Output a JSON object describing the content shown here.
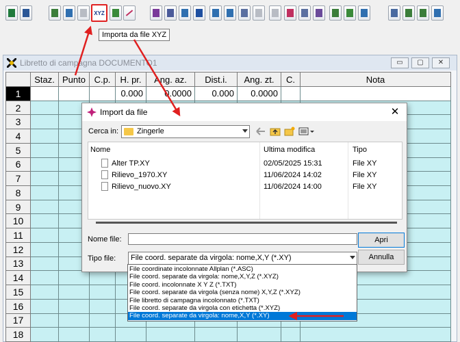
{
  "tooltip": "Importa da file XYZ",
  "toolbar": {
    "xyz_button_text": "XYZ",
    "icons": [
      "excel-icon",
      "word-icon",
      "tool-icon",
      "tool-icon",
      "tool-icon",
      "import-xyz-icon",
      "tool-icon",
      "line-icon",
      "tool-icon",
      "tool-icon",
      "tool-icon",
      "tool-icon",
      "tool-icon",
      "tool-icon",
      "tool-icon",
      "tool-icon",
      "tool-icon",
      "tool-icon",
      "tool-icon",
      "tool-icon",
      "tool-icon",
      "tool-icon",
      "tool-icon",
      "tool-icon",
      "tool-icon",
      "tool-icon",
      "tool-icon"
    ]
  },
  "window": {
    "title": "Libretto di campagna DOCUMENTO1",
    "buttons": [
      "▭",
      "▢",
      "✕"
    ]
  },
  "grid": {
    "columns": [
      "",
      "Staz.",
      "Punto",
      "C.p.",
      "H. pr.",
      "Ang. az.",
      "Dist.i.",
      "Ang. zt.",
      "C.",
      "Nota"
    ],
    "first_row": [
      "1",
      "",
      "",
      "",
      "0.000",
      "0.0000",
      "0.000",
      "0.0000",
      "",
      ""
    ],
    "row_numbers": [
      "2",
      "3",
      "4",
      "5",
      "6",
      "7",
      "8",
      "9",
      "10",
      "11",
      "12",
      "13",
      "14",
      "15",
      "16",
      "17",
      "18"
    ]
  },
  "dialog": {
    "title": "Import da file",
    "close": "✕",
    "look_in_label": "Cerca in:",
    "look_in_value": "Zingerle",
    "columns": {
      "name": "Nome",
      "modified": "Ultima modifica",
      "type": "Tipo"
    },
    "files": [
      {
        "name": "Alter TP.XY",
        "modified": "02/05/2025 15:31",
        "type": "File XY"
      },
      {
        "name": "Rilievo_1970.XY",
        "modified": "11/06/2024 14:02",
        "type": "File XY"
      },
      {
        "name": "Rilievo_nuovo.XY",
        "modified": "11/06/2024 14:00",
        "type": "File XY"
      }
    ],
    "filename_label": "Nome file:",
    "filename_value": "",
    "filetype_label": "Tipo file:",
    "filetype_value": "File coord. separate da virgola: nome,X,Y (*.XY)",
    "open_button": "Apri",
    "cancel_button": "Annulla"
  },
  "filetype_options": [
    "File coordinate incolonnate Allplan (*.ASC)",
    "File coord. separate da virgola: nome,X,Y,Z (*.XYZ)",
    "File coord. incolonnate X Y Z (*.TXT)",
    "File coord. separate da virgola (senza nome) X,Y,Z (*.XYZ)",
    "File libretto di campagna incolonnato (*.TXT)",
    "File coord. separate da virgola con etichetta (*.XYZ)",
    "File coord. separate da virgola: nome,X,Y (*.XY)"
  ],
  "selected_option_index": 6,
  "colors": {
    "grid_cell": "#c8f0f3",
    "selection": "#0078d7",
    "annotation_arrow": "#e02020"
  }
}
